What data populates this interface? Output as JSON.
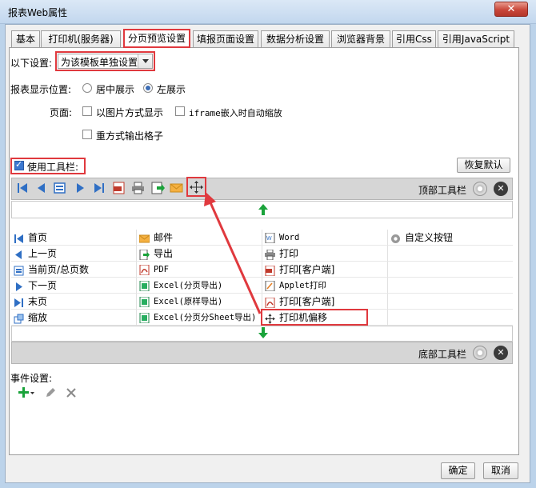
{
  "window": {
    "title": "报表Web属性",
    "close_glyph": "✕"
  },
  "tabs": [
    "基本",
    "打印机(服务器)",
    "分页预览设置",
    "填报页面设置",
    "数据分析设置",
    "浏览器背景",
    "引用Css",
    "引用JavaScript"
  ],
  "settings": {
    "mode_label": "以下设置:",
    "mode_value": "为该模板单独设置",
    "position_label": "报表显示位置:",
    "position_options": [
      "居中展示",
      "左展示"
    ],
    "page_label": "页面:",
    "page_options": [
      "以图片方式显示",
      "iframe嵌入时自动缩放",
      "重方式输出格子"
    ],
    "use_toolbar_label": "使用工具栏:",
    "restore_default": "恢复默认"
  },
  "top_toolbar": {
    "label": "顶部工具栏"
  },
  "bottom_toolbar": {
    "label": "底部工具栏"
  },
  "buttons_grid": {
    "col1": [
      "首页",
      "上一页",
      "当前页/总页数",
      "下一页",
      "末页",
      "缩放"
    ],
    "col2": [
      "邮件",
      "导出",
      "PDF",
      "Excel(分页导出)",
      "Excel(原样导出)",
      "Excel(分页分Sheet导出)"
    ],
    "col3": [
      "Word",
      "打印",
      "打印[客户端]",
      "Applet打印",
      "打印[客户端]",
      "打印机偏移"
    ],
    "col4": [
      "自定义按钮"
    ]
  },
  "events": {
    "label": "事件设置:"
  },
  "footer": {
    "ok": "确定",
    "cancel": "取消"
  },
  "colors": {
    "highlight": "#e0393e",
    "nav_blue": "#2f6fc4",
    "arrow_green": "#1aa33a"
  }
}
